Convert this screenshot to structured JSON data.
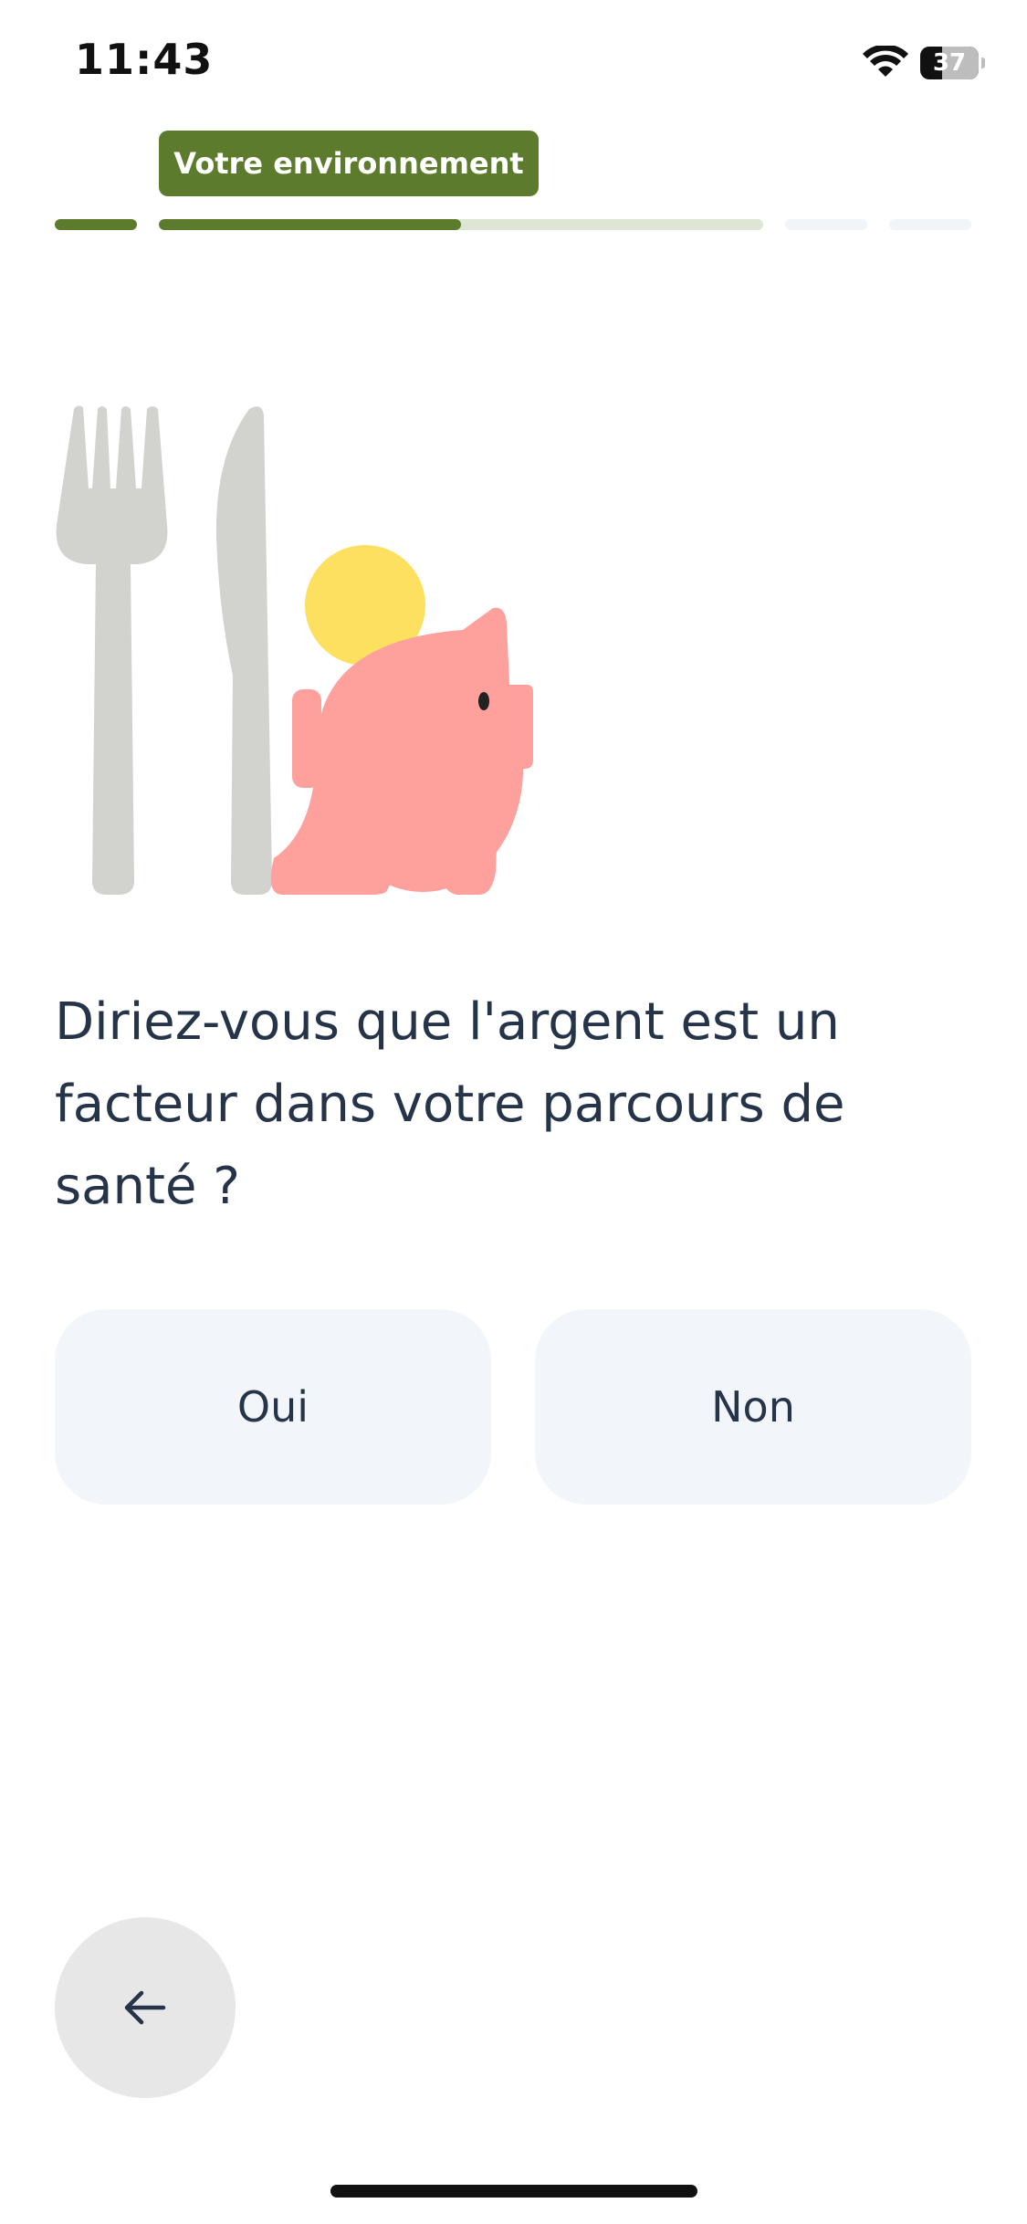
{
  "status_bar": {
    "time": "11:43",
    "battery_level": "37",
    "icons": [
      "wifi-icon",
      "battery-icon"
    ]
  },
  "progress": {
    "section_label": "Votre environnement",
    "segments_total": 4,
    "current_segment": 2,
    "current_segment_fraction": 0.5,
    "active_color": "#5c7b2c",
    "track_color": "#dde5d4"
  },
  "illustration": {
    "icons": [
      "fork-icon",
      "knife-icon",
      "piggy-bank-icon",
      "coin-icon"
    ]
  },
  "question": {
    "text": "Diriez-vous que l'argent est un facteur dans votre parcours de santé ?"
  },
  "answers": {
    "yes_label": "Oui",
    "no_label": "Non"
  },
  "navigation": {
    "back_icon": "arrow-left-icon"
  }
}
